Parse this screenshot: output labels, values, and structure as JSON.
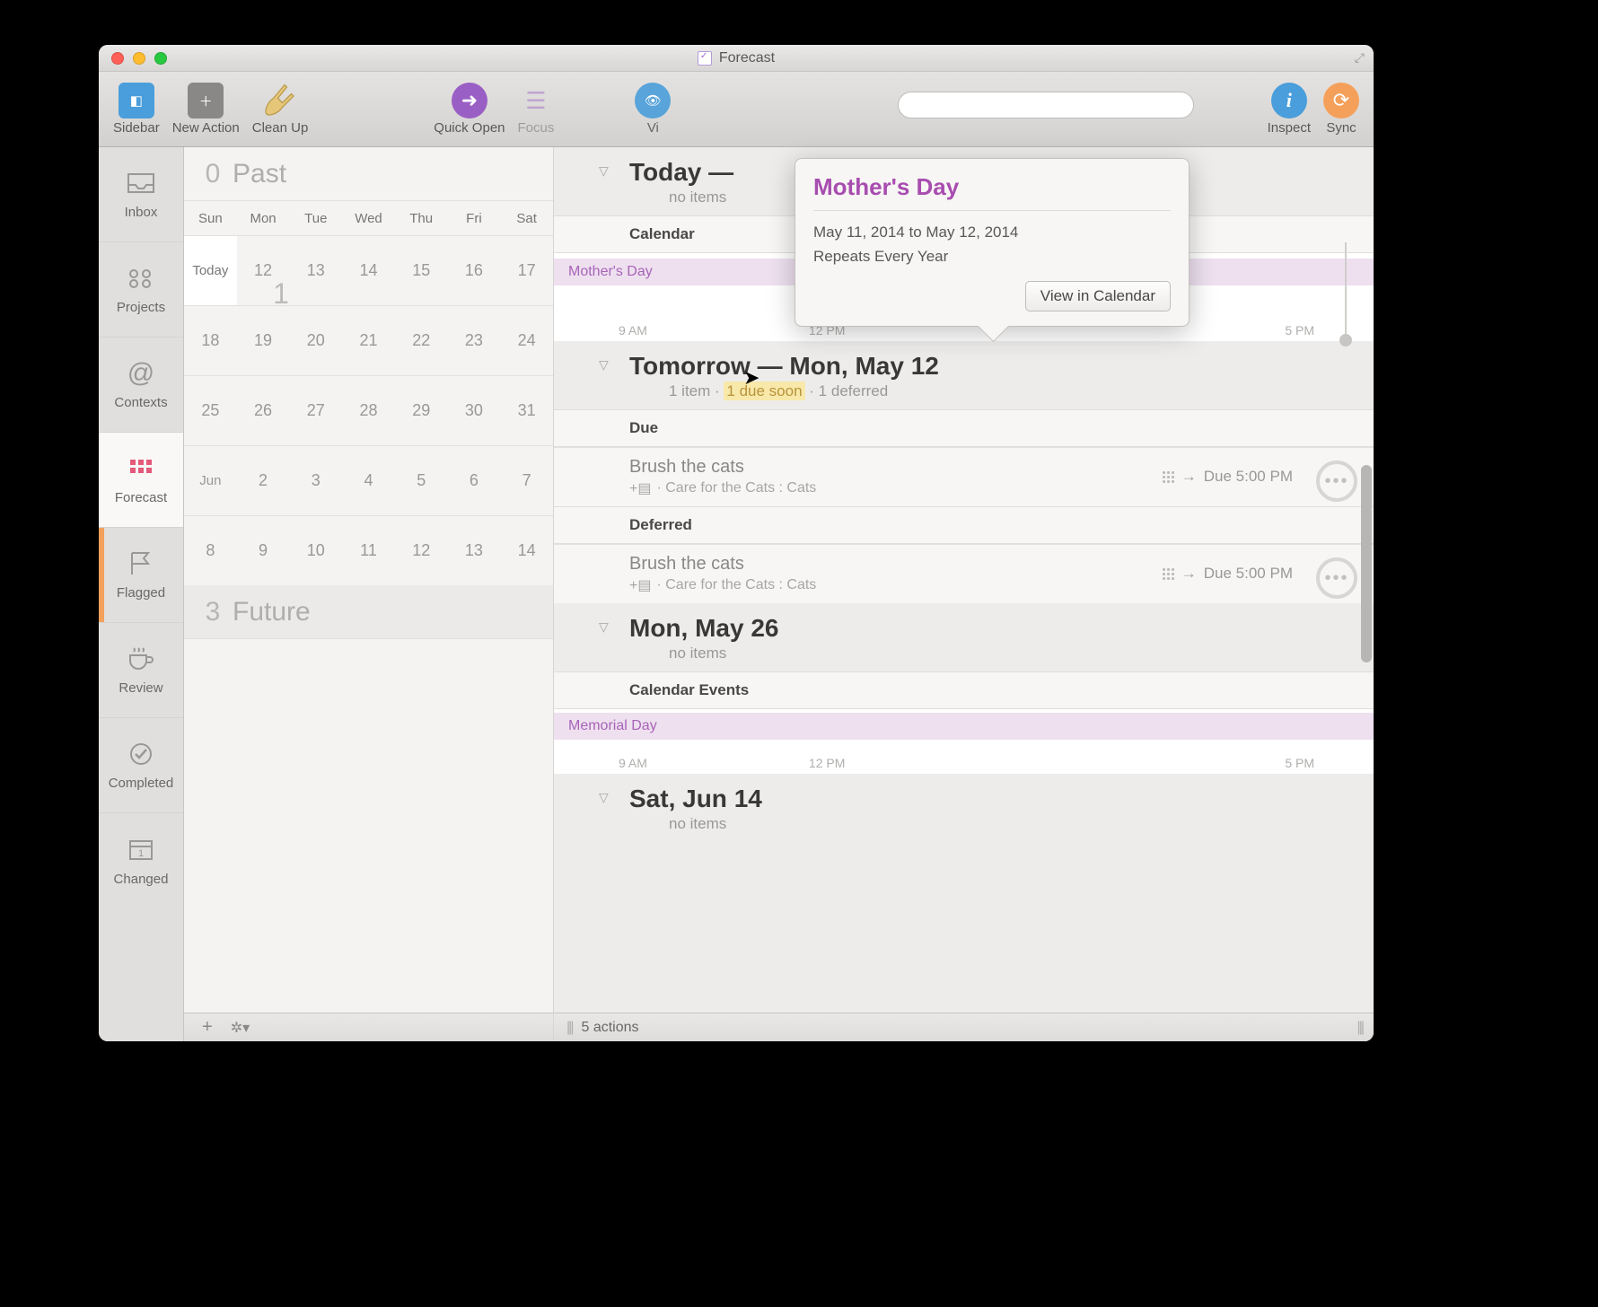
{
  "window": {
    "title": "Forecast"
  },
  "toolbar": {
    "sidebar": "Sidebar",
    "new_action": "New Action",
    "clean_up": "Clean Up",
    "quick_open": "Quick Open",
    "focus": "Focus",
    "view_partial": "Vi",
    "inspect": "Inspect",
    "sync": "Sync"
  },
  "perspectives": {
    "inbox": "Inbox",
    "projects": "Projects",
    "contexts": "Contexts",
    "forecast": "Forecast",
    "flagged": "Flagged",
    "review": "Review",
    "completed": "Completed",
    "changed": "Changed"
  },
  "minical": {
    "past_count": "0",
    "past_label": "Past",
    "future_count": "3",
    "future_label": "Future",
    "weekdays": [
      "Sun",
      "Mon",
      "Tue",
      "Wed",
      "Thu",
      "Fri",
      "Sat"
    ],
    "rows": [
      [
        "Today",
        "12",
        "13",
        "14",
        "15",
        "16",
        "17"
      ],
      [
        "18",
        "19",
        "20",
        "21",
        "22",
        "23",
        "24"
      ],
      [
        "25",
        "26",
        "27",
        "28",
        "29",
        "30",
        "31"
      ],
      [
        "Jun",
        "2",
        "3",
        "4",
        "5",
        "6",
        "7"
      ],
      [
        "8",
        "9",
        "10",
        "11",
        "12",
        "13",
        "14"
      ]
    ],
    "big_one": "1"
  },
  "popover": {
    "title": "Mother's Day",
    "dates": "May 11, 2014 to May 12, 2014",
    "repeat": "Repeats Every Year",
    "button": "View in Calendar"
  },
  "main": {
    "today": {
      "title_prefix": "Today —",
      "sub": "no items",
      "section": "Calendar",
      "event": "Mother's Day",
      "times": [
        "9 AM",
        "12 PM",
        "5 PM"
      ]
    },
    "tomorrow": {
      "title": "Tomorrow — Mon, May 12",
      "sub_a": "1 item ·",
      "sub_highlight": "1 due soon",
      "sub_b": "· 1 deferred",
      "due_label": "Due",
      "deferred_label": "Deferred",
      "task_title": "Brush the cats",
      "task_sub": "· Care for the Cats : Cats",
      "task_due": "Due 5:00 PM"
    },
    "may26": {
      "title": "Mon, May 26",
      "sub": "no items",
      "section": "Calendar Events",
      "event": "Memorial Day",
      "times": [
        "9 AM",
        "12 PM",
        "5 PM"
      ]
    },
    "jun14": {
      "title": "Sat, Jun 14",
      "sub": "no items"
    }
  },
  "status": {
    "actions": "5 actions",
    "plus": "+",
    "gear": "✻▾"
  },
  "colors": {
    "accent_purple": "#a84db0",
    "flag_orange": "#f5a05a",
    "forecast_red": "#e35a7a"
  }
}
